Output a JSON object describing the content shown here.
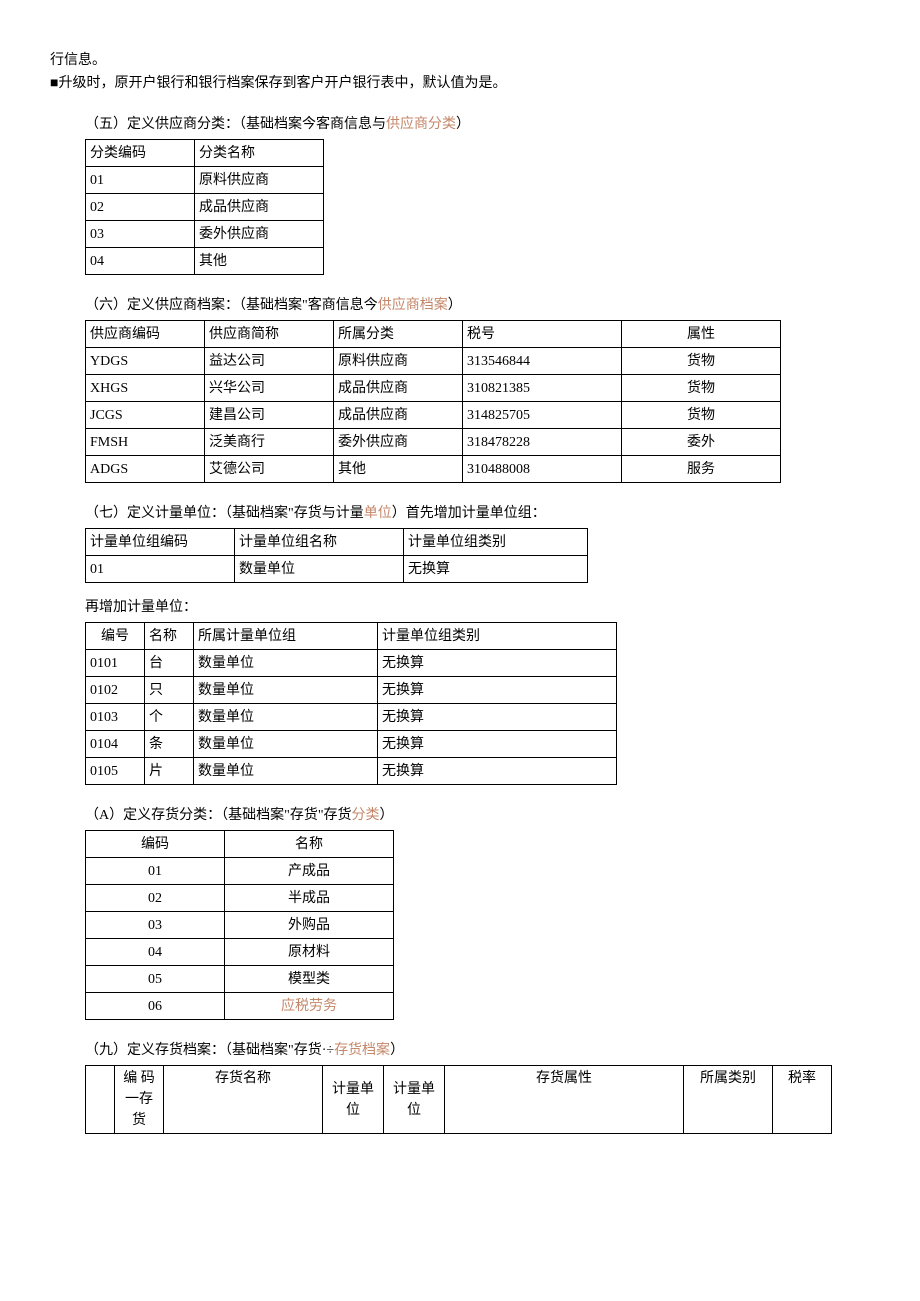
{
  "intro": {
    "line1": "行信息。",
    "line2_prefix": "■升级时，原开户银行和银行档案保存到客户开户银行表中，默认值为是。"
  },
  "sec5": {
    "title_prefix": "（五）定义供应商分类：（基础档案今客商信息与",
    "title_hl": "供应商分类",
    "title_suffix": "）",
    "header": [
      "分类编码",
      "分类名称"
    ],
    "rows": [
      [
        "01",
        "原料供应商"
      ],
      [
        "02",
        "成品供应商"
      ],
      [
        "03",
        "委外供应商"
      ],
      [
        "04",
        "其他"
      ]
    ]
  },
  "sec6": {
    "title_prefix": "（六）定义供应商档案：（基础档案\"客商信息今",
    "title_hl": "供应商档案",
    "title_suffix": "）",
    "header": [
      "供应商编码",
      "供应商简称",
      "所属分类",
      "税号",
      "属性"
    ],
    "rows": [
      [
        "YDGS",
        "益达公司",
        "原料供应商",
        "313546844",
        "货物"
      ],
      [
        "XHGS",
        "兴华公司",
        "成品供应商",
        "310821385",
        "货物"
      ],
      [
        "JCGS",
        "建昌公司",
        "成品供应商",
        "314825705",
        "货物"
      ],
      [
        "FMSH",
        "泛美商行",
        "委外供应商",
        "318478228",
        "委外"
      ],
      [
        "ADGS",
        "艾德公司",
        "其他",
        "310488008",
        "服务"
      ]
    ]
  },
  "sec7": {
    "title_prefix": "（七）定义计量单位：（基础档案\"存货与计量",
    "title_hl": "单位",
    "title_suffix": "）首先增加计量单位组：",
    "header": [
      "计量单位组编码",
      "计量单位组名称",
      "计量单位组类别"
    ],
    "rows": [
      [
        "01",
        "数量单位",
        "无换算"
      ]
    ],
    "sub_label": "再增加计量单位：",
    "sub_header": [
      "编号",
      "名称",
      "所属计量单位组",
      "计量单位组类别"
    ],
    "sub_rows": [
      [
        "0101",
        "台",
        "数量单位",
        "无换算"
      ],
      [
        "0102",
        "只",
        "数量单位",
        "无换算"
      ],
      [
        "0103",
        "个",
        "数量单位",
        "无换算"
      ],
      [
        "0104",
        "条",
        "数量单位",
        "无换算"
      ],
      [
        "0105",
        "片",
        "数量单位",
        "无换算"
      ]
    ]
  },
  "secA": {
    "title_prefix": "（A）定义存货分类：（基础档案\"存货\"存货",
    "title_hl": "分类",
    "title_suffix": "）",
    "header": [
      "编码",
      "名称"
    ],
    "rows": [
      [
        "01",
        "产成品"
      ],
      [
        "02",
        "半成品"
      ],
      [
        "03",
        "外购品"
      ],
      [
        "04",
        "原材料"
      ],
      [
        "05",
        "模型类"
      ],
      [
        "06",
        "应税劳务"
      ]
    ]
  },
  "sec9": {
    "title_prefix": "（九）定义存货档案：（基础档案\"存货·÷",
    "title_hl": "存货档案",
    "title_suffix": "）",
    "h_blank": "",
    "h_code": "编 码一存货",
    "h_name": "存货名称",
    "h_u1": "计量单位",
    "h_u2": "计量单位",
    "h_attr": "存货属性",
    "h_cat": "所属类别",
    "h_tax": "税率"
  }
}
